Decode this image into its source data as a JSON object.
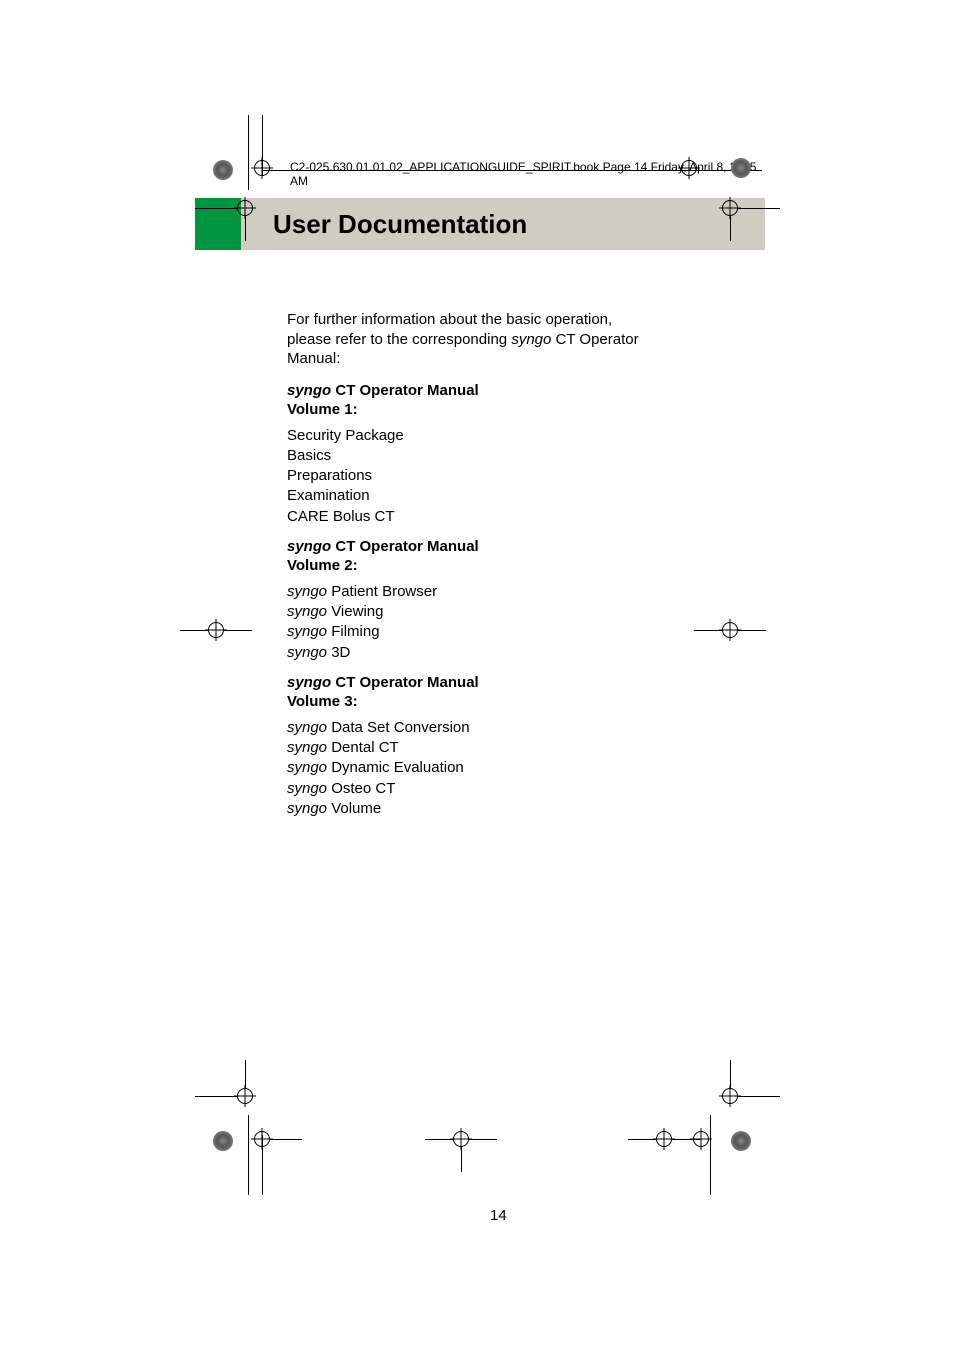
{
  "header_line": "C2-025.630.01.01.02_APPLICATIONGUIDE_SPIRIT.book  Page 14  Friday, April 8, 2005  AM",
  "title": "User Documentation",
  "intro": {
    "line1": "For further information about the basic operation,",
    "line2_prefix": "please refer to the corresponding ",
    "line2_syngo": "syngo",
    "line2_suffix": " CT Operator",
    "line3": "Manual:"
  },
  "volumes": [
    {
      "heading_syngo": "syngo",
      "heading_rest": " CT Operator Manual",
      "subheading": "Volume 1:",
      "items": [
        {
          "prefix": "",
          "text": "Security Package"
        },
        {
          "prefix": "",
          "text": "Basics"
        },
        {
          "prefix": "",
          "text": "Preparations"
        },
        {
          "prefix": "",
          "text": "Examination"
        },
        {
          "prefix": "",
          "text": "CARE Bolus CT"
        }
      ]
    },
    {
      "heading_syngo": "syngo",
      "heading_rest": " CT Operator Manual",
      "subheading": "Volume 2:",
      "items": [
        {
          "prefix": "syngo",
          "text": " Patient Browser"
        },
        {
          "prefix": "syngo",
          "text": " Viewing"
        },
        {
          "prefix": "syngo",
          "text": " Filming"
        },
        {
          "prefix": "syngo",
          "text": " 3D"
        }
      ]
    },
    {
      "heading_syngo": "syngo",
      "heading_rest": " CT Operator Manual",
      "subheading": "Volume 3:",
      "items": [
        {
          "prefix": "syngo",
          "text": " Data Set Conversion"
        },
        {
          "prefix": "syngo",
          "text": " Dental CT"
        },
        {
          "prefix": "syngo",
          "text": " Dynamic Evaluation"
        },
        {
          "prefix": "syngo",
          "text": " Osteo CT"
        },
        {
          "prefix": "syngo",
          "text": " Volume"
        }
      ]
    }
  ],
  "page_number": "14"
}
